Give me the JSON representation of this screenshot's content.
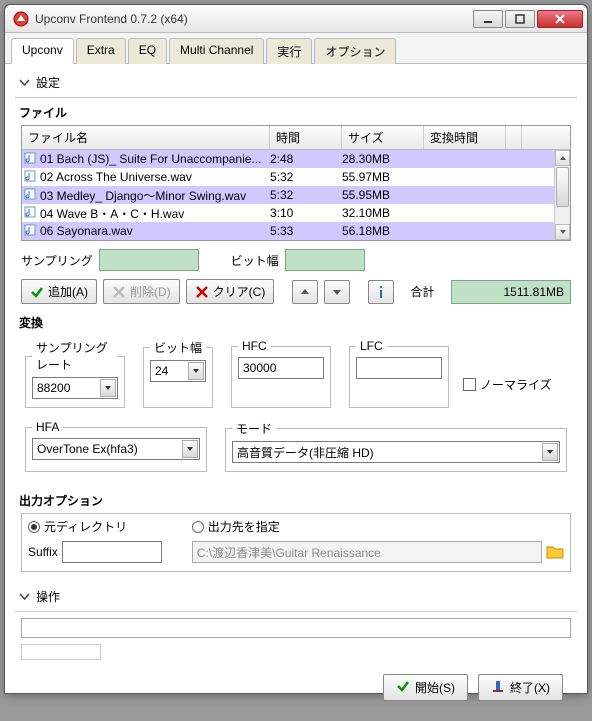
{
  "window": {
    "title": "Upconv Frontend 0.7.2 (x64)"
  },
  "tabs": [
    "Upconv",
    "Extra",
    "EQ",
    "Multi Channel",
    "実行",
    "オプション"
  ],
  "active_tab": 0,
  "settings_label": "設定",
  "file_section": {
    "heading": "ファイル",
    "columns": {
      "name": "ファイル名",
      "time": "時間",
      "size": "サイズ",
      "convtime": "変換時間"
    },
    "rows": [
      {
        "name": "01 Bach (JS)_ Suite For Unaccompanie...",
        "time": "2:48",
        "size": "28.30MB",
        "selected": true
      },
      {
        "name": "02 Across The Universe.wav",
        "time": "5:32",
        "size": "55.97MB",
        "selected": false
      },
      {
        "name": "03 Medley_ Django～Minor Swing.wav",
        "time": "5:32",
        "size": "55.95MB",
        "selected": true
      },
      {
        "name": "04 Wave B・A・C・H.wav",
        "time": "3:10",
        "size": "32.10MB",
        "selected": false
      },
      {
        "name": "06 Sayonara.wav",
        "time": "5:33",
        "size": "56.18MB",
        "selected": true
      }
    ],
    "sampling_label": "サンプリング",
    "bitwidth_label": "ビット幅",
    "add_btn": "追加(A)",
    "del_btn": "削除(D)",
    "clear_btn": "クリア(C)",
    "total_label": "合計",
    "total_value": "1511.81MB"
  },
  "convert": {
    "heading": "変換",
    "rate_label": "サンプリングレート",
    "rate_value": "88200",
    "bit_label": "ビット幅",
    "bit_value": "24",
    "hfc_label": "HFC",
    "hfc_value": "30000",
    "lfc_label": "LFC",
    "lfc_value": "",
    "normalize_label": "ノーマライズ",
    "hfa_label": "HFA",
    "hfa_value": "OverTone Ex(hfa3)",
    "mode_label": "モード",
    "mode_value": "高音質データ(非圧縮 HD)"
  },
  "output": {
    "heading": "出力オプション",
    "orig_dir": "元ディレクトリ",
    "suffix_label": "Suffix",
    "suffix_value": "",
    "specify_label": "出力先を指定",
    "path": "C:\\渡辺香津美\\Guitar Renaissance"
  },
  "ops_label": "操作",
  "footer": {
    "start": "開始(S)",
    "exit": "終了(X)"
  }
}
